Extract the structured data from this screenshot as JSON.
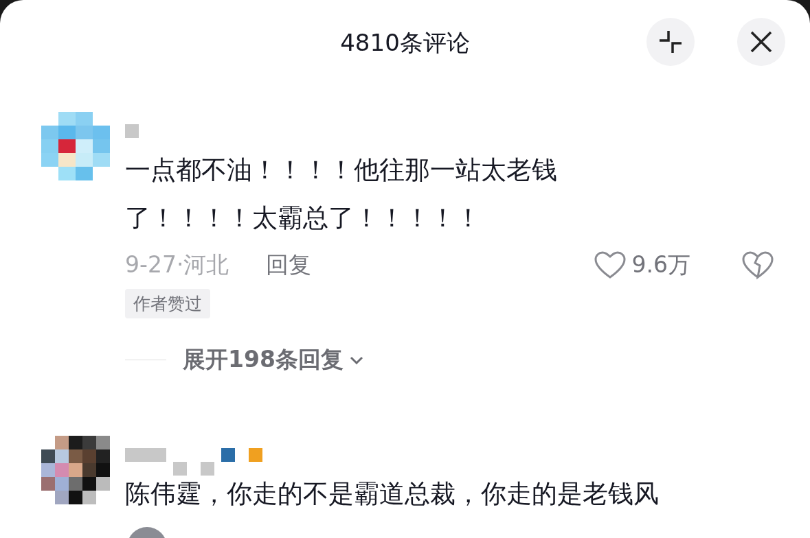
{
  "header": {
    "title": "4810条评论"
  },
  "comments": [
    {
      "text": "一点都不油！！！！他往那一站太老钱了！！！！太霸总了！！！！！",
      "date_location": "9-27·河北",
      "reply": "回复",
      "likes": "9.6万",
      "tag": "作者赞过",
      "expand": "展开198条回复"
    },
    {
      "text": "陈伟霆，你走的不是霸道总裁，你走的是老钱风"
    }
  ]
}
